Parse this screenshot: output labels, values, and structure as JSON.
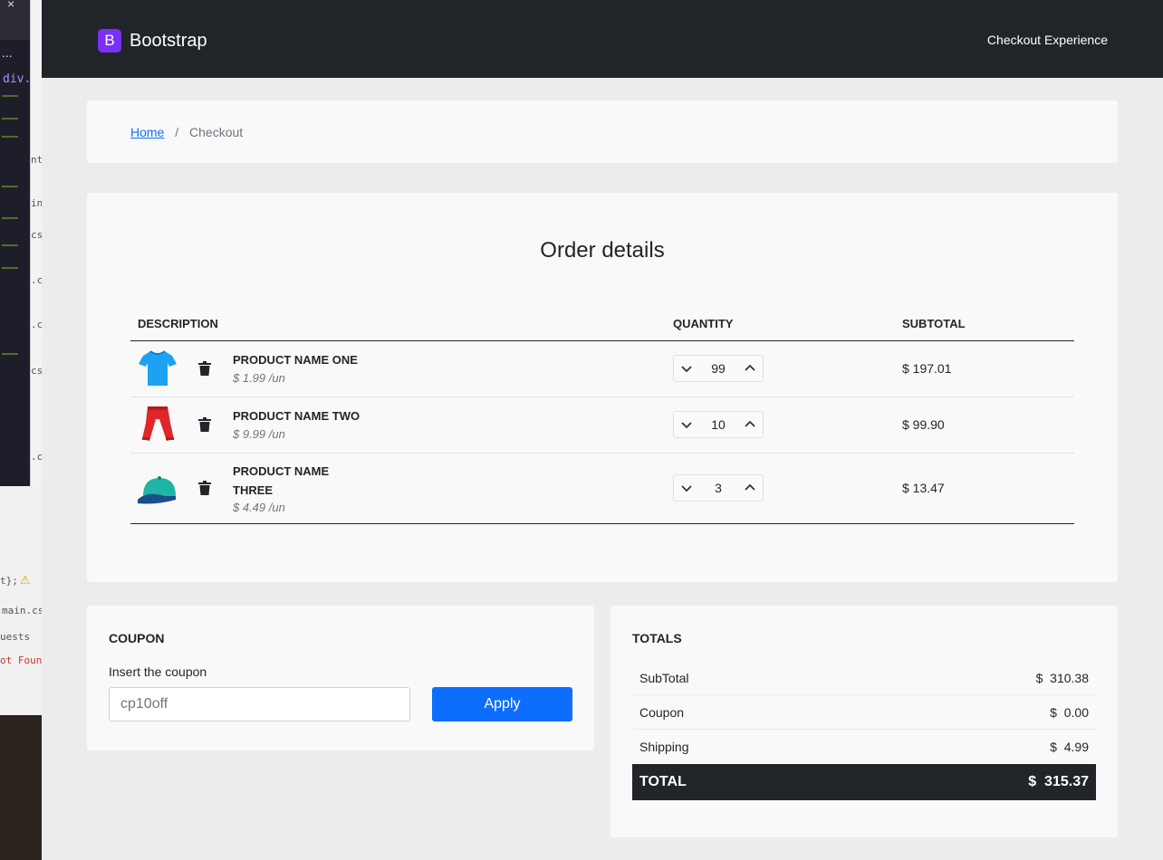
{
  "background_window": {
    "close_glyph": "×",
    "ellipsis": "...",
    "breadcrumb_fragment": "div.d",
    "snippets": [
      "nt",
      "in",
      "cs",
      ".c",
      ".c",
      "cs",
      ".c"
    ],
    "tab_file": "main.cs",
    "tab_requests": "uests",
    "error_text": "ot Found",
    "code_fragment": "t};"
  },
  "navbar": {
    "brand_letter": "B",
    "brand_name": "Bootstrap",
    "right_link": "Checkout Experience"
  },
  "breadcrumb": {
    "home": "Home",
    "separator": "/",
    "current": "Checkout"
  },
  "order": {
    "title": "Order details",
    "headers": {
      "description": "DESCRIPTION",
      "quantity": "QUANTITY",
      "subtotal": "SUBTOTAL"
    },
    "items": [
      {
        "name": "PRODUCT NAME ONE",
        "unit_price": "$ 1.99 /un",
        "quantity": "99",
        "subtotal": "$ 197.01",
        "image": "blue-tshirt-icon"
      },
      {
        "name": "PRODUCT NAME TWO",
        "unit_price": "$ 9.99 /un",
        "quantity": "10",
        "subtotal": "$ 99.90",
        "image": "red-pants-icon"
      },
      {
        "name": "PRODUCT NAME THREE",
        "unit_price": "$ 4.49 /un",
        "quantity": "3",
        "subtotal": "$ 13.47",
        "image": "teal-cap-icon"
      }
    ]
  },
  "coupon": {
    "title": "COUPON",
    "label": "Insert the coupon",
    "placeholder": "cp10off",
    "value": "",
    "apply_label": "Apply"
  },
  "totals": {
    "title": "TOTALS",
    "rows": [
      {
        "label": "SubTotal",
        "value": "$  310.38"
      },
      {
        "label": "Coupon",
        "value": "$  0.00"
      },
      {
        "label": "Shipping",
        "value": "$  4.99"
      }
    ],
    "grand_label": "TOTAL",
    "grand_value": "$  315.37"
  },
  "colors": {
    "navbar_bg": "#212529",
    "brand_purple": "#7b2ff7",
    "primary_blue": "#0d6efd",
    "total_bar_bg": "#212529"
  }
}
